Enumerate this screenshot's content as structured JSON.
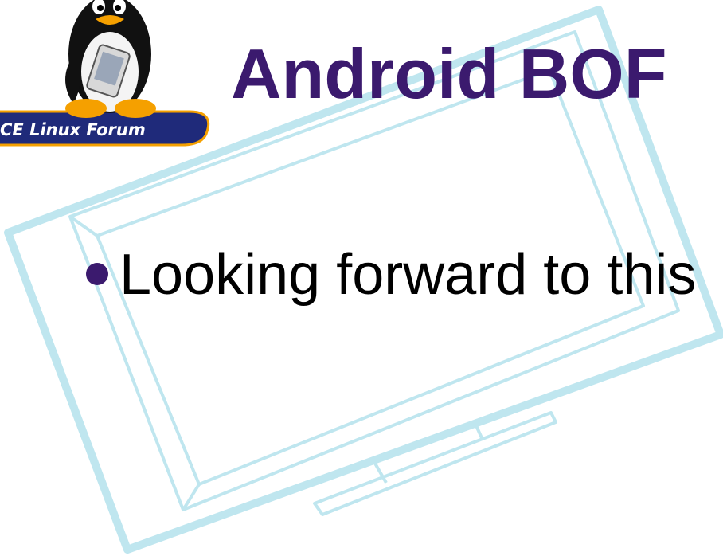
{
  "slide": {
    "title": "Android BOF",
    "logo_text": "CE Linux Forum",
    "bullets": [
      {
        "text": "Looking forward to this"
      }
    ]
  },
  "colors": {
    "title": "#3b1a6e",
    "bullet": "#3b1a6e",
    "body_text": "#000000",
    "background_art": "#bfe6ef",
    "logo_banner": "#1f2a7a",
    "logo_accent": "#f5a000"
  },
  "icons": {
    "logo": "cel-tux-penguin-icon",
    "background": "tablet-device-outline"
  }
}
